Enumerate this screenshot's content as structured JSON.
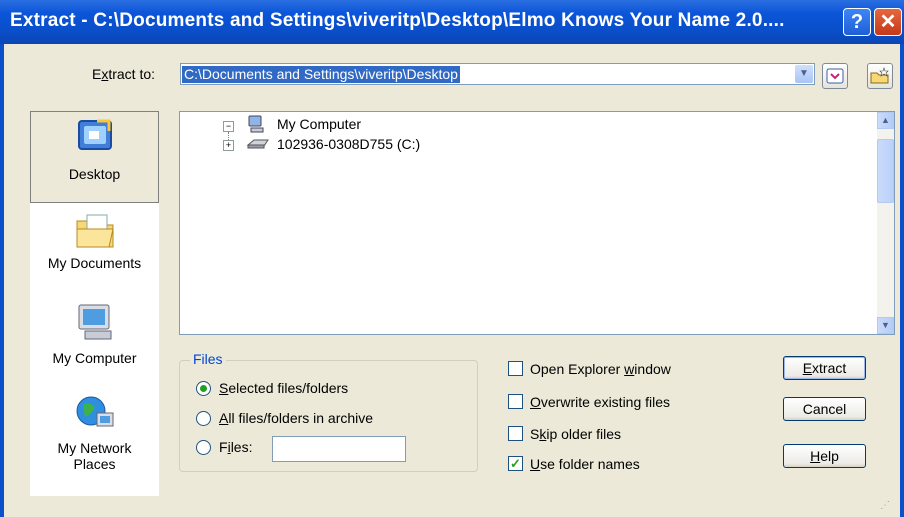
{
  "window": {
    "title": "Extract - C:\\Documents and Settings\\viveritp\\Desktop\\Elmo Knows Your Name 2.0....",
    "help_glyph": "?",
    "close_glyph": "✕"
  },
  "extract_to": {
    "label_pre": "E",
    "label_key": "x",
    "label_post": "tract to:",
    "value": "C:\\Documents and Settings\\viveritp\\Desktop"
  },
  "places": [
    {
      "label": "Desktop",
      "icon": "desktop-icon",
      "selected": true
    },
    {
      "label": "My Documents",
      "icon": "my-documents-icon",
      "selected": false
    },
    {
      "label": "My Computer",
      "icon": "my-computer-icon",
      "selected": false
    },
    {
      "label_line1": "My Network",
      "label_line2": "Places",
      "icon": "network-places-icon",
      "selected": false
    }
  ],
  "tree": {
    "root": {
      "label": "My Computer",
      "icon": "computer-icon",
      "expanded": true
    },
    "child": {
      "label": "102936-0308D755 (C:)",
      "icon": "drive-icon",
      "expanded": false
    }
  },
  "files_group": {
    "title": "Files",
    "options": [
      {
        "pre": "",
        "key": "S",
        "post": "elected files/folders",
        "selected": true
      },
      {
        "pre": "",
        "key": "A",
        "post": "ll files/folders in archive",
        "selected": false
      },
      {
        "pre": "F",
        "key": "i",
        "post": "les:",
        "selected": false
      }
    ],
    "files_value": ""
  },
  "options": [
    {
      "pre": "Open Explorer ",
      "key": "w",
      "post": "indow",
      "checked": false
    },
    {
      "pre": "",
      "key": "O",
      "post": "verwrite existing files",
      "checked": false
    },
    {
      "pre": "S",
      "key": "k",
      "post": "ip older files",
      "checked": false
    },
    {
      "pre": "",
      "key": "U",
      "post": "se folder names",
      "checked": true
    }
  ],
  "buttons": {
    "extract": {
      "pre": "",
      "key": "E",
      "post": "xtract"
    },
    "cancel": {
      "label": "Cancel"
    },
    "help": {
      "pre": "",
      "key": "H",
      "post": "elp"
    }
  },
  "colors": {
    "titlebar": "#0b55d8",
    "dialog_bg": "#ece9d8",
    "selection": "#316ac5",
    "group_title": "#0046d5"
  }
}
